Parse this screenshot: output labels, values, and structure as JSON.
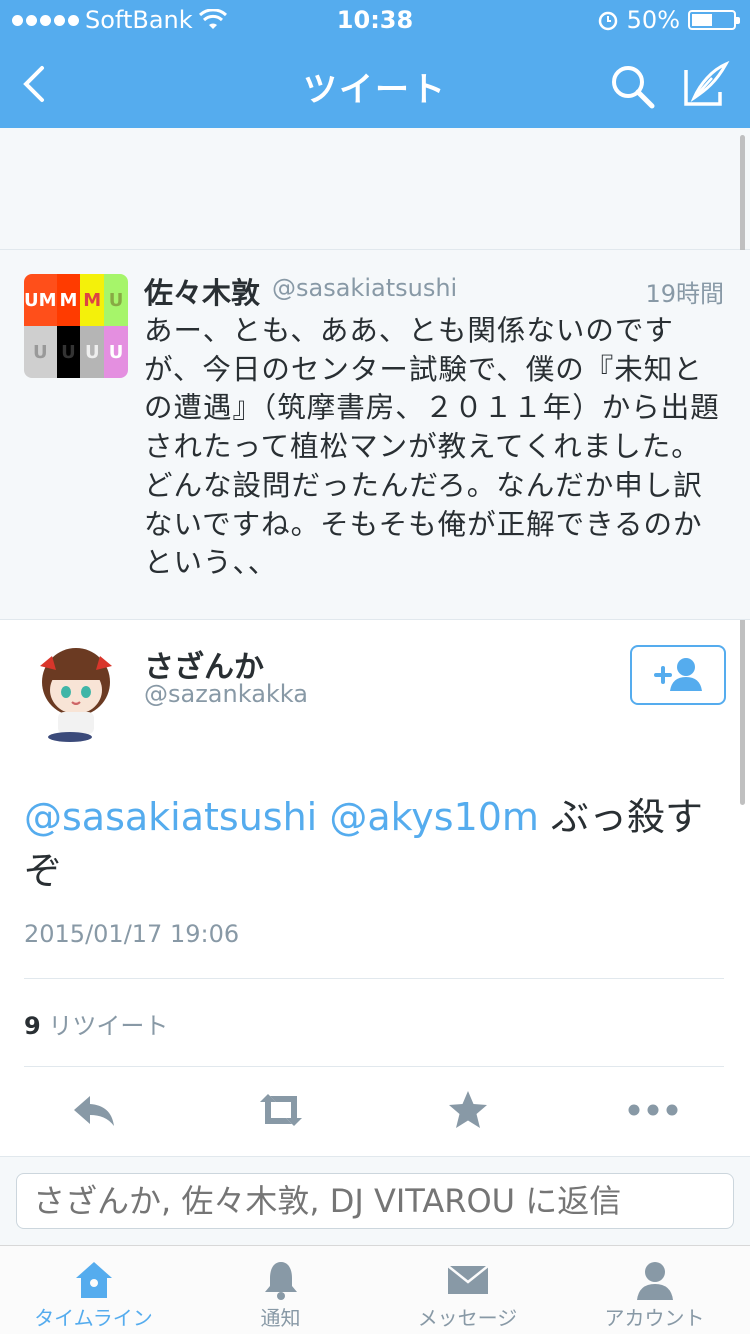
{
  "status_bar": {
    "carrier": "SoftBank",
    "time": "10:38",
    "battery_percent": "50%",
    "battery_level": 0.5
  },
  "nav": {
    "title": "ツイート",
    "back_icon": "chevron-left-icon",
    "search_icon": "search-icon",
    "compose_icon": "compose-icon"
  },
  "parent_tweet": {
    "name": "佐々木敦",
    "handle": "@sasakiatsushi",
    "time": "19時間",
    "text": "あー、とも、ああ、とも関係ないのですが、今日のセンター試験で、僕の『未知との遭遇』（筑摩書房、２０１１年）から出題されたって植松マンが教えてくれました。どんな設問だったんだろ。なんだか申し訳ないですね。そもそも俺が正解できるのかという、、",
    "avatar_text": [
      "UM",
      "M",
      "M",
      "U",
      "U",
      "U",
      "U",
      "U"
    ]
  },
  "main_tweet": {
    "name": "さざんか",
    "handle": "@sazankakka",
    "mention1": "@sasakiatsushi",
    "mention2": "@akys10m",
    "text": "ぶっ殺すぞ",
    "date": "2015/01/17 19:06",
    "retweet_count": "9",
    "retweet_label": "リツイート"
  },
  "reply": {
    "placeholder": "さざんか, 佐々木敦, DJ VITAROU に返信"
  },
  "tabs": [
    {
      "label": "タイムライン",
      "icon": "home-icon",
      "active": true
    },
    {
      "label": "通知",
      "icon": "bell-icon",
      "active": false
    },
    {
      "label": "メッセージ",
      "icon": "envelope-icon",
      "active": false
    },
    {
      "label": "アカウント",
      "icon": "person-icon",
      "active": false
    }
  ],
  "colors": {
    "brand": "#55acee",
    "text": "#292f33",
    "muted": "#8899a6"
  }
}
